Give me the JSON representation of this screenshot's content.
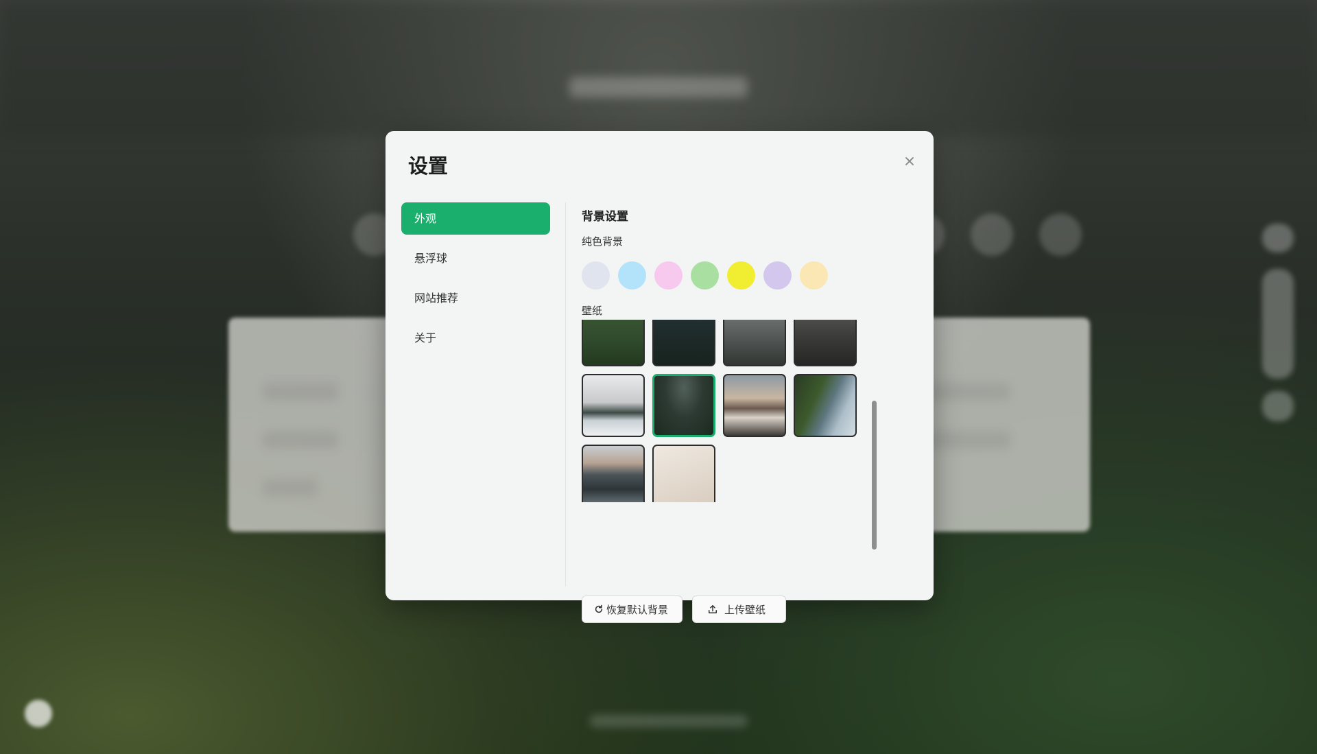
{
  "modal": {
    "title": "设置"
  },
  "nav": {
    "items": [
      {
        "label": "外观",
        "active": true
      },
      {
        "label": "悬浮球",
        "active": false
      },
      {
        "label": "网站推荐",
        "active": false
      },
      {
        "label": "关于",
        "active": false
      }
    ]
  },
  "background": {
    "section_title": "背景设置",
    "solid_label": "纯色背景",
    "solid_colors": [
      "#dfe4ee",
      "#b3e3fa",
      "#f7c9ee",
      "#a9e0a2",
      "#f1ee32",
      "#d4c7ee",
      "#fae7b3"
    ],
    "wallpaper_label": "壁纸",
    "wallpapers": [
      {
        "name": "green-field",
        "selected": false
      },
      {
        "name": "dark-forest",
        "selected": false
      },
      {
        "name": "foggy-forest",
        "selected": false
      },
      {
        "name": "misty-trees",
        "selected": false
      },
      {
        "name": "snowy-forest-fog",
        "selected": false
      },
      {
        "name": "pine-forest",
        "selected": true
      },
      {
        "name": "volcano-clouds",
        "selected": false
      },
      {
        "name": "coastal-cliffs",
        "selected": false
      },
      {
        "name": "rocky-mountains",
        "selected": false
      },
      {
        "name": "beige-abstract",
        "selected": false
      }
    ],
    "reset_label": "恢复默认背景",
    "upload_label": "上传壁纸"
  },
  "colors": {
    "accent": "#1aaf6c"
  }
}
